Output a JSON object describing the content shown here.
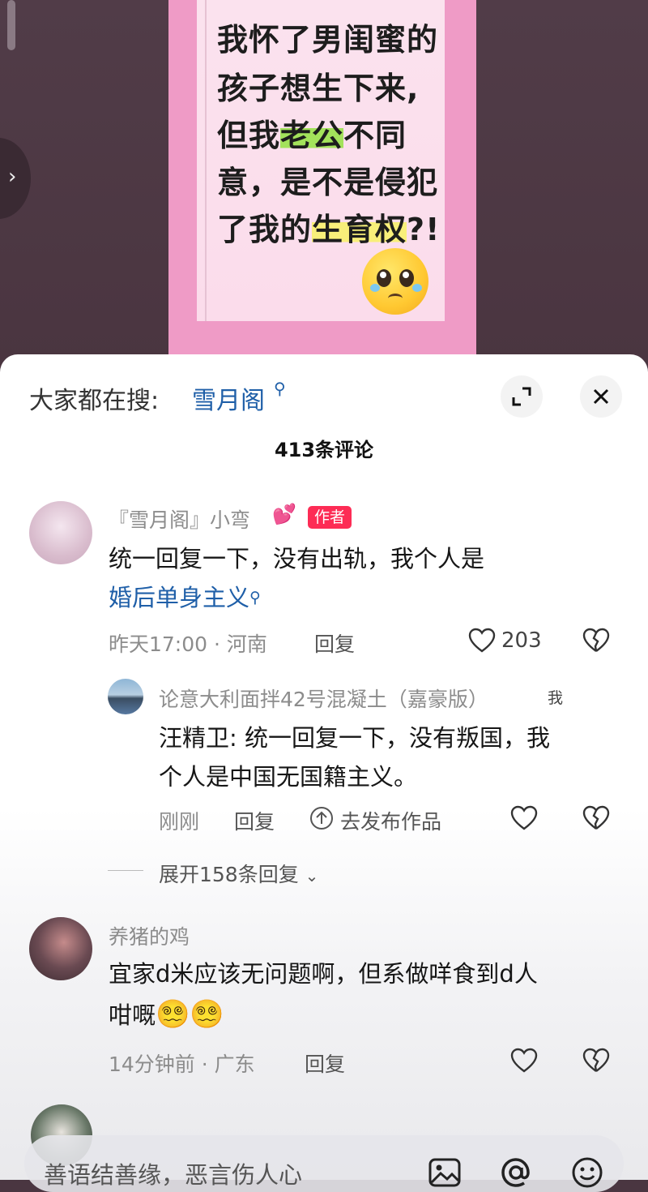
{
  "video": {
    "title_lines": [
      {
        "text": "我怀了男闺蜜的"
      },
      {
        "text": "孩子想生下来,"
      },
      {
        "pre": "但我",
        "highlight": "老公",
        "post": "不同"
      },
      {
        "text": "意，是不是侵犯"
      },
      {
        "pre": "了我的",
        "highlight": "生育权",
        "post": "?!"
      }
    ],
    "emoji": "pleading-face"
  },
  "sheet": {
    "search_label": "大家都在搜:",
    "search_term": "雪月阁",
    "comment_count": "413条评论",
    "expand_icon": "expand-icon",
    "close_icon": "close-icon"
  },
  "comments": [
    {
      "username": "『雪月阁』小弯",
      "author_tag": "作者",
      "text_line1": "统一回复一下，没有出轨，我个人是",
      "text_line2": "婚后单身主义",
      "time": "昨天17:00",
      "location": "河南",
      "reply_label": "回复",
      "likes": "203"
    },
    {
      "username": "论意大利面拌42号混凝土（嘉豪版）",
      "me_tag": "我",
      "text_line1": "汪精卫: 统一回复一下，没有叛国，我",
      "text_line2": "个人是中国无国籍主义。",
      "time": "刚刚",
      "reply_label": "回复",
      "publish_label": "去发布作品"
    },
    {
      "expand_replies": "展开158条回复"
    },
    {
      "username": "养猪的鸡",
      "text_line1": "宜家d米应该无问题啊，但系做咩食到d人",
      "text_line2": "咁嘅",
      "time": "14分钟前",
      "location": "广东",
      "reply_label": "回复"
    }
  ],
  "input": {
    "placeholder": "善语结善缘，恶言伤人心"
  },
  "colors": {
    "accent_link": "#1f5fa8",
    "author_tag": "#fd2c55",
    "card_pink": "#ef9bc6",
    "highlight_green": "#a3e25b",
    "highlight_yellow": "#f8ef7a"
  }
}
